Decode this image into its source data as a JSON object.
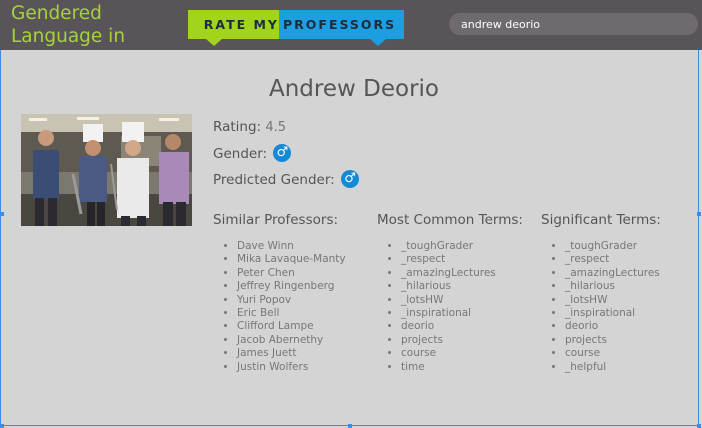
{
  "header": {
    "app_title": "Gendered Language in",
    "logo_rate": "RATE MY",
    "logo_professors": "PROFESSORS",
    "search_value": "andrew deorio"
  },
  "professor": {
    "name": "Andrew Deorio",
    "rating_label": "Rating:",
    "rating_value": "4.5",
    "gender_label": "Gender:",
    "gender_symbol": "♂",
    "predicted_gender_label": "Predicted Gender:",
    "predicted_gender_symbol": "♂"
  },
  "similar_professors": {
    "heading": "Similar Professors:",
    "items": [
      "Dave Winn",
      "Mika Lavaque-Manty",
      "Peter Chen",
      "Jeffrey Ringenberg",
      "Yuri Popov",
      "Eric Bell",
      "Clifford Lampe",
      "Jacob Abernethy",
      "James Juett",
      "Justin Wolfers"
    ]
  },
  "common_terms": {
    "heading": "Most Common Terms:",
    "items": [
      "_toughGrader",
      "_respect",
      "_amazingLectures",
      "_hilarious",
      "_lotsHW",
      "_inspirational",
      "deorio",
      "projects",
      "course",
      "time"
    ]
  },
  "significant_terms": {
    "heading": "Significant Terms:",
    "items": [
      "_toughGrader",
      "_respect",
      "_amazingLectures",
      "_hilarious",
      "_lotsHW",
      "_inspirational",
      "deorio",
      "projects",
      "course",
      "_helpful"
    ]
  },
  "colors": {
    "header_bg": "#595459",
    "title_green": "#a6d23a",
    "logo_green": "#a3d41c",
    "logo_blue": "#1d9ee0",
    "male_icon_blue": "#1489d6",
    "page_bg": "#d4d4d4"
  },
  "icons": {
    "gender": "male-symbol-icon",
    "predicted_gender": "male-symbol-icon"
  }
}
